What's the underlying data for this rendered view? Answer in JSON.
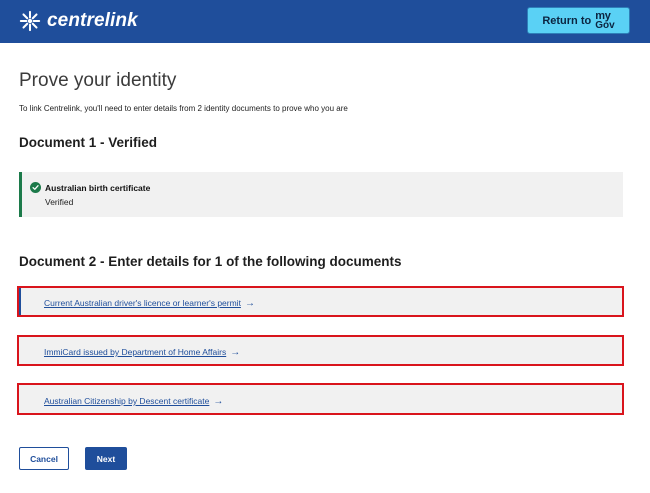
{
  "header": {
    "brand": "centrelink",
    "return_button": {
      "label": "Return to",
      "mygov_top": "my",
      "mygov_bottom": "Gov"
    }
  },
  "page": {
    "title": "Prove your identity",
    "intro": "To link Centrelink, you'll need to enter details from 2 identity documents to prove who you are"
  },
  "document1": {
    "heading": "Document 1 - Verified",
    "card": {
      "title": "Australian birth certificate",
      "status": "Verified"
    }
  },
  "document2": {
    "heading_prefix": "Document 2 - Enter details for ",
    "heading_count": "1",
    "heading_suffix": " of the following documents",
    "options": [
      {
        "label": "Current Australian driver's licence or learner's permit"
      },
      {
        "label": "ImmiCard issued by Department of Home Affairs"
      },
      {
        "label": "Australian Citizenship by Descent certificate"
      }
    ]
  },
  "actions": {
    "cancel": "Cancel",
    "next": "Next"
  },
  "colors": {
    "header_blue": "#1f4e9b",
    "mygov_cyan": "#5ad1f5",
    "verified_green": "#1c7a4a",
    "highlight_red": "#d9141c",
    "card_grey": "#f1f1f1"
  }
}
